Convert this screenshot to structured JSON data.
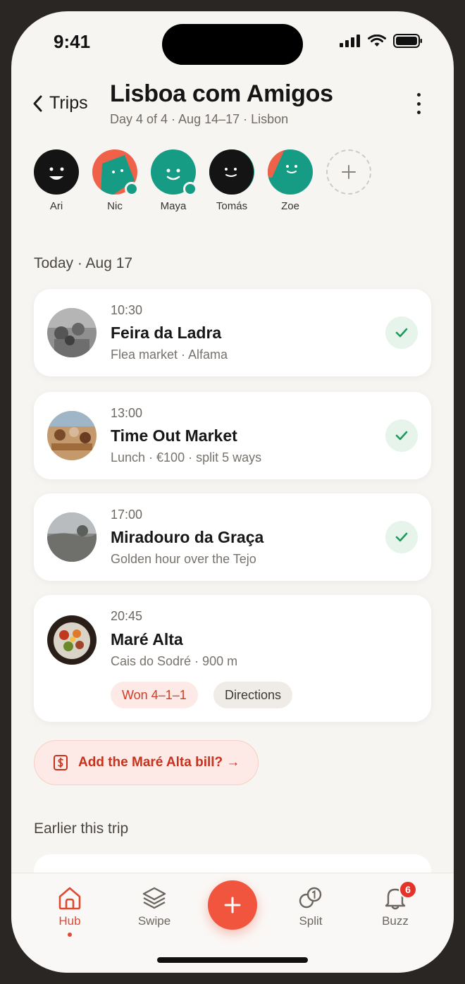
{
  "status": {
    "time": "9:41"
  },
  "header": {
    "back_label": "Trips",
    "title": "Lisboa com Amigos",
    "subtitle": "Day 4 of 4 · Aug 14–17 · Lisbon"
  },
  "members": [
    {
      "name": "Ari",
      "online": false
    },
    {
      "name": "Nic",
      "online": true
    },
    {
      "name": "Maya",
      "online": true
    },
    {
      "name": "Tomás",
      "online": false
    },
    {
      "name": "Zoe",
      "online": false
    }
  ],
  "today_label": "Today · Aug 17",
  "itinerary": [
    {
      "time": "10:30",
      "title": "Feira da Ladra",
      "subtitle": "Flea market · Alfama",
      "done": true
    },
    {
      "time": "13:00",
      "title": "Time Out Market",
      "subtitle": "Lunch · €100 · split 5 ways",
      "done": true
    },
    {
      "time": "17:00",
      "title": "Miradouro da Graça",
      "subtitle": "Golden hour over the Tejo",
      "done": true
    },
    {
      "time": "20:45",
      "title": "Maré Alta",
      "subtitle": "Cais do Sodré · 900 m",
      "done": false,
      "vote_label": "Won 4–1–1",
      "directions_label": "Directions"
    }
  ],
  "bill_prompt": "Add the Maré Alta bill? →",
  "earlier_label": "Earlier this trip",
  "tabs": [
    {
      "label": "Hub",
      "icon": "home-icon",
      "active": true
    },
    {
      "label": "Swipe",
      "icon": "layers-icon",
      "active": false
    },
    {
      "label": "Split",
      "icon": "coins-icon",
      "active": false
    },
    {
      "label": "Buzz",
      "icon": "bell-icon",
      "active": false,
      "badge": "6"
    }
  ],
  "colors": {
    "accent": "#f2553d",
    "teal": "#169c85",
    "coral": "#f0614a",
    "check_green": "#1f9a5a"
  }
}
